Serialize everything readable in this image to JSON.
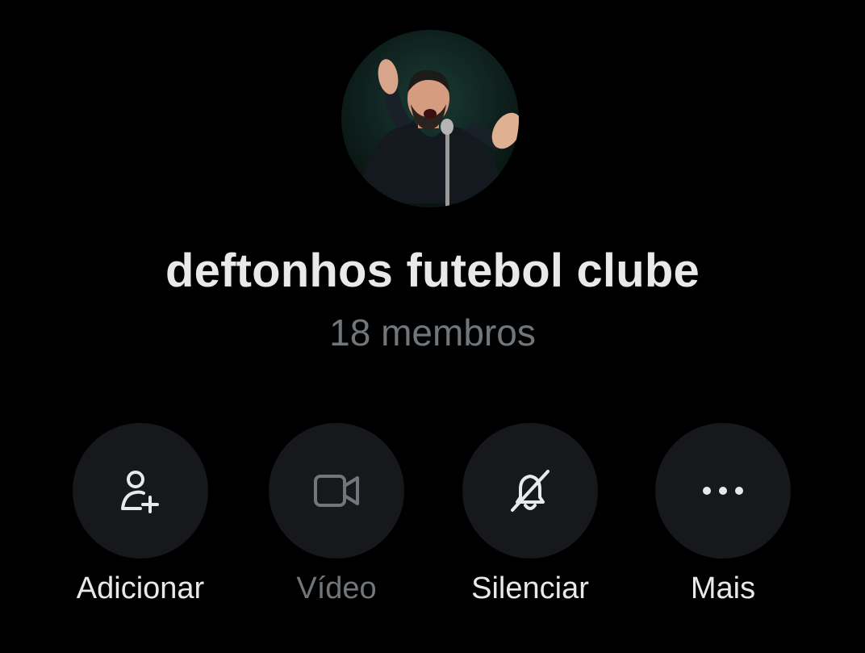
{
  "group": {
    "name": "deftonhos futebol clube",
    "members": "18 membros"
  },
  "actions": [
    {
      "label": "Adicionar",
      "icon": "add-person-icon",
      "enabled": true
    },
    {
      "label": "Vídeo",
      "icon": "video-icon",
      "enabled": false
    },
    {
      "label": "Silenciar",
      "icon": "bell-muted-icon",
      "enabled": true
    },
    {
      "label": "Mais",
      "icon": "more-dots-icon",
      "enabled": true
    }
  ],
  "colors": {
    "background": "#000000",
    "primary_text": "#e7e9ea",
    "secondary_text": "#71767b",
    "button_bg": "#16181c"
  }
}
